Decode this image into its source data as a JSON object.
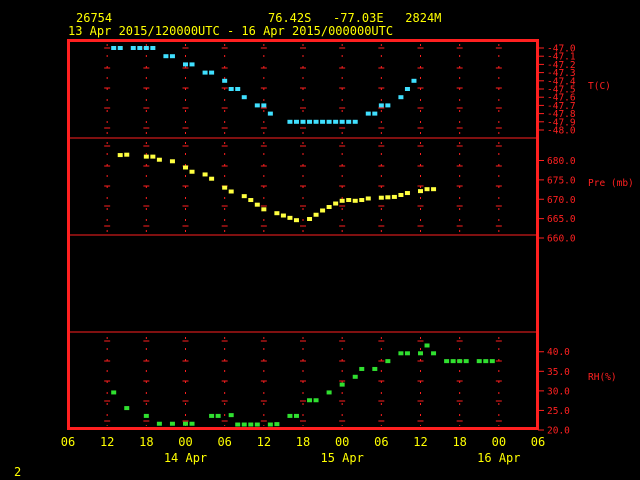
{
  "header": {
    "station_id": "26754",
    "location": "76.42S   -77.03E   2824M",
    "time_range": "13 Apr 2015/120000UTC - 16 Apr 2015/000000UTC"
  },
  "page_number": "2",
  "colors": {
    "background": "#000000",
    "frame": "#ff2020",
    "header_text": "#ffff00",
    "axis_text": "#ffff00",
    "panel_text": "#ff2020",
    "temperature": "#40e0ff",
    "pressure": "#ffff40",
    "humidity": "#30e030",
    "grid_markers": "#ff2020"
  },
  "x_axis": {
    "tick_labels": [
      "06",
      "12",
      "18",
      "00",
      "06",
      "12",
      "18",
      "00",
      "06",
      "12",
      "18",
      "00",
      "06"
    ],
    "day_labels": [
      {
        "label": "14 Apr",
        "hour": 24
      },
      {
        "label": "15 Apr",
        "hour": 48
      },
      {
        "label": "16 Apr",
        "hour": 72
      }
    ]
  },
  "chart_data": [
    {
      "type": "scatter",
      "ylabel": "T(C)",
      "ylim": [
        -48.0,
        -47.0
      ],
      "yticks": [
        "-47.0",
        "-47.1",
        "-47.2",
        "-47.3",
        "-47.4",
        "-47.5",
        "-47.6",
        "-47.7",
        "-47.8",
        "-47.9",
        "-48.0"
      ],
      "x_unit": "hours since 13 Apr 2015 00UTC",
      "xlim": [
        6,
        78
      ],
      "points": [
        [
          13,
          -47.0
        ],
        [
          14,
          -47.0
        ],
        [
          16,
          -47.0
        ],
        [
          17,
          -47.0
        ],
        [
          18,
          -47.0
        ],
        [
          19,
          -47.0
        ],
        [
          21,
          -47.1
        ],
        [
          22,
          -47.1
        ],
        [
          24,
          -47.2
        ],
        [
          25,
          -47.2
        ],
        [
          27,
          -47.3
        ],
        [
          28,
          -47.3
        ],
        [
          30,
          -47.4
        ],
        [
          31,
          -47.5
        ],
        [
          32,
          -47.5
        ],
        [
          33,
          -47.6
        ],
        [
          35,
          -47.7
        ],
        [
          36,
          -47.7
        ],
        [
          37,
          -47.8
        ],
        [
          40,
          -47.9
        ],
        [
          41,
          -47.9
        ],
        [
          42,
          -47.9
        ],
        [
          43,
          -47.9
        ],
        [
          44,
          -47.9
        ],
        [
          45,
          -47.9
        ],
        [
          46,
          -47.9
        ],
        [
          47,
          -47.9
        ],
        [
          48,
          -47.9
        ],
        [
          49,
          -47.9
        ],
        [
          50,
          -47.9
        ],
        [
          52,
          -47.8
        ],
        [
          53,
          -47.8
        ],
        [
          54,
          -47.7
        ],
        [
          55,
          -47.7
        ],
        [
          57,
          -47.6
        ],
        [
          58,
          -47.5
        ],
        [
          59,
          -47.4
        ]
      ]
    },
    {
      "type": "scatter",
      "ylabel": "Pre (mb)",
      "ylim": [
        660.0,
        684.0
      ],
      "yticks": [
        "680.0",
        "675.0",
        "670.0",
        "665.0",
        "660.0"
      ],
      "x_unit": "hours since 13 Apr 2015 00UTC",
      "xlim": [
        6,
        78
      ],
      "points": [
        [
          14,
          681.4
        ],
        [
          15,
          681.5
        ],
        [
          18,
          681.0
        ],
        [
          19,
          681.0
        ],
        [
          20,
          680.2
        ],
        [
          22,
          679.8
        ],
        [
          24,
          678.2
        ],
        [
          25,
          677.1
        ],
        [
          27,
          676.4
        ],
        [
          28,
          675.3
        ],
        [
          30,
          673.0
        ],
        [
          31,
          672.0
        ],
        [
          33,
          670.8
        ],
        [
          34,
          669.8
        ],
        [
          35,
          668.6
        ],
        [
          36,
          667.4
        ],
        [
          38,
          666.4
        ],
        [
          39,
          665.8
        ],
        [
          40,
          665.2
        ],
        [
          41,
          664.6
        ],
        [
          43,
          664.9
        ],
        [
          44,
          666.0
        ],
        [
          45,
          667.1
        ],
        [
          46,
          668.0
        ],
        [
          47,
          668.9
        ],
        [
          48,
          669.6
        ],
        [
          49,
          669.8
        ],
        [
          50,
          669.6
        ],
        [
          51,
          669.8
        ],
        [
          52,
          670.2
        ],
        [
          54,
          670.4
        ],
        [
          55,
          670.5
        ],
        [
          56,
          670.6
        ],
        [
          57,
          671.1
        ],
        [
          58,
          671.6
        ],
        [
          60,
          672.1
        ],
        [
          61,
          672.6
        ],
        [
          62,
          672.6
        ]
      ]
    },
    {
      "type": "scatter",
      "ylabel": "RH(%)",
      "ylim": [
        20.0,
        43.0
      ],
      "yticks": [
        "40.0",
        "35.0",
        "30.0",
        "25.0",
        "20.0"
      ],
      "x_unit": "hours since 13 Apr 2015 00UTC",
      "xlim": [
        6,
        78
      ],
      "points": [
        [
          13,
          29.6
        ],
        [
          15,
          25.6
        ],
        [
          18,
          23.6
        ],
        [
          20,
          21.6
        ],
        [
          22,
          21.6
        ],
        [
          24,
          21.6
        ],
        [
          25,
          21.6
        ],
        [
          28,
          23.6
        ],
        [
          29,
          23.6
        ],
        [
          31,
          23.8
        ],
        [
          32,
          21.4
        ],
        [
          33,
          21.4
        ],
        [
          34,
          21.4
        ],
        [
          35,
          21.4
        ],
        [
          37,
          21.4
        ],
        [
          38,
          21.5
        ],
        [
          40,
          23.6
        ],
        [
          41,
          23.6
        ],
        [
          43,
          27.6
        ],
        [
          44,
          27.6
        ],
        [
          46,
          29.6
        ],
        [
          48,
          31.6
        ],
        [
          50,
          33.6
        ],
        [
          51,
          35.6
        ],
        [
          53,
          35.6
        ],
        [
          55,
          37.6
        ],
        [
          57,
          39.6
        ],
        [
          58,
          39.6
        ],
        [
          60,
          39.6
        ],
        [
          61,
          41.6
        ],
        [
          62,
          39.6
        ],
        [
          64,
          37.6
        ],
        [
          65,
          37.6
        ],
        [
          66,
          37.6
        ],
        [
          67,
          37.6
        ],
        [
          69,
          37.6
        ],
        [
          70,
          37.6
        ],
        [
          71,
          37.6
        ]
      ]
    }
  ]
}
